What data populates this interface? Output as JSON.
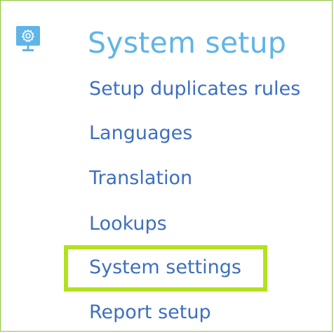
{
  "section": {
    "icon": "gear-monitor-icon",
    "title": "System setup",
    "accent_color": "#5fb4e8",
    "link_color": "#3d6fbf",
    "highlight_color": "#b2e21f",
    "items": [
      {
        "label": "Setup duplicates rules"
      },
      {
        "label": "Languages"
      },
      {
        "label": "Translation"
      },
      {
        "label": "Lookups"
      },
      {
        "label": "System settings",
        "highlighted": true
      },
      {
        "label": "Report setup"
      }
    ]
  }
}
